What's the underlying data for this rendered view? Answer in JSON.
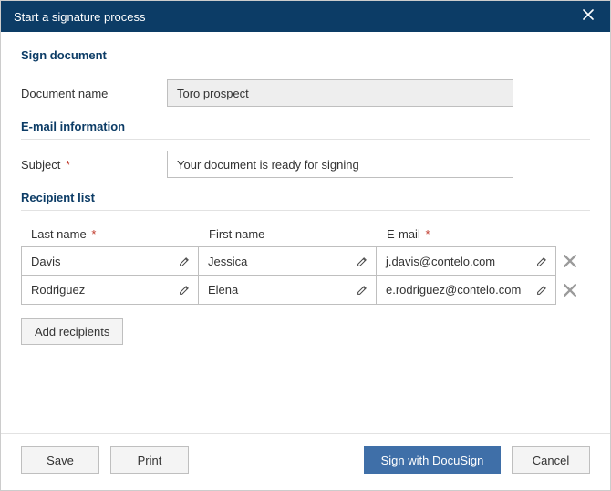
{
  "dialog": {
    "title": "Start a signature process"
  },
  "sections": {
    "sign_document": "Sign document",
    "email_info": "E-mail information",
    "recipient_list": "Recipient list"
  },
  "fields": {
    "document_name_label": "Document name",
    "document_name_value": "Toro prospect",
    "subject_label": "Subject",
    "subject_value": "Your document is ready for signing"
  },
  "recip_headers": {
    "last_name": "Last name",
    "first_name": "First name",
    "email": "E-mail"
  },
  "recipients": [
    {
      "last": "Davis",
      "first": "Jessica",
      "email": "j.davis@contelo.com"
    },
    {
      "last": "Rodriguez",
      "first": "Elena",
      "email": "e.rodriguez@contelo.com"
    }
  ],
  "buttons": {
    "add_recipients": "Add recipients",
    "save": "Save",
    "print": "Print",
    "sign": "Sign with DocuSign",
    "cancel": "Cancel"
  }
}
